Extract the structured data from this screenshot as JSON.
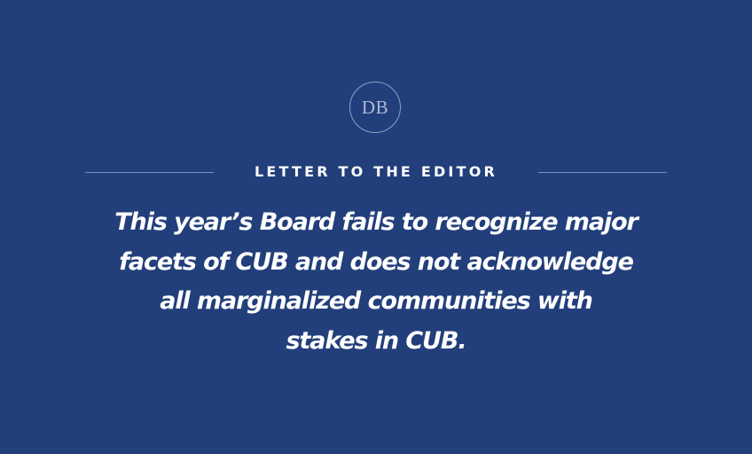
{
  "logo": {
    "text": "DB"
  },
  "kicker": "LETTER TO THE EDITOR",
  "headline": {
    "lines": [
      "This year’s Board fails to recognize major",
      "facets of CUB and does not acknowledge",
      "all marginalized communities with",
      "stakes in CUB."
    ]
  },
  "colors": {
    "background": "#223f7b",
    "text": "#ffffff",
    "rule": "#7e8fbb"
  }
}
